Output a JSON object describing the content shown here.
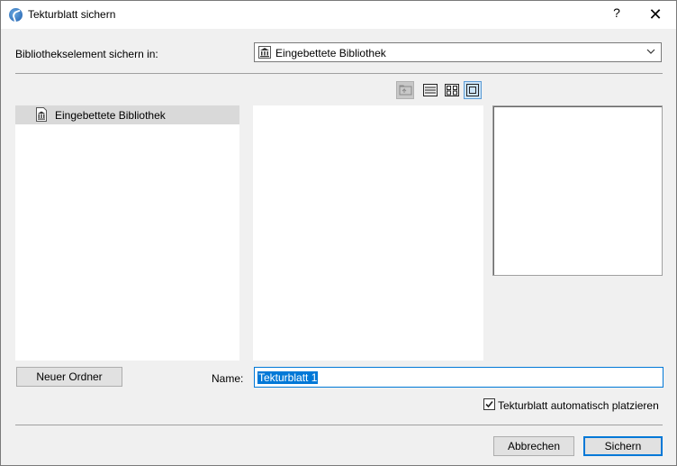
{
  "window": {
    "title": "Tekturblatt sichern",
    "help": "?",
    "close": "✕"
  },
  "save_in": {
    "label": "Bibliothekselement sichern in:",
    "selected": "Eingebettete Bibliothek"
  },
  "toolbar": {
    "buttons": [
      {
        "icon": "folder-up-icon",
        "state": "disabled"
      },
      {
        "icon": "list-view-icon",
        "state": "normal"
      },
      {
        "icon": "thumbnail-view-icon",
        "state": "normal"
      },
      {
        "icon": "preview-view-icon",
        "state": "active"
      }
    ]
  },
  "tree": {
    "items": [
      {
        "label": "Eingebettete Bibliothek",
        "icon": "library-icon",
        "selected": true
      }
    ]
  },
  "new_folder_label": "Neuer Ordner",
  "name": {
    "label": "Name:",
    "value": "Tekturblatt 1"
  },
  "auto_place": {
    "label": "Tekturblatt automatisch platzieren",
    "checked": true
  },
  "footer": {
    "cancel_label": "Abbrechen",
    "save_label": "Sichern"
  }
}
